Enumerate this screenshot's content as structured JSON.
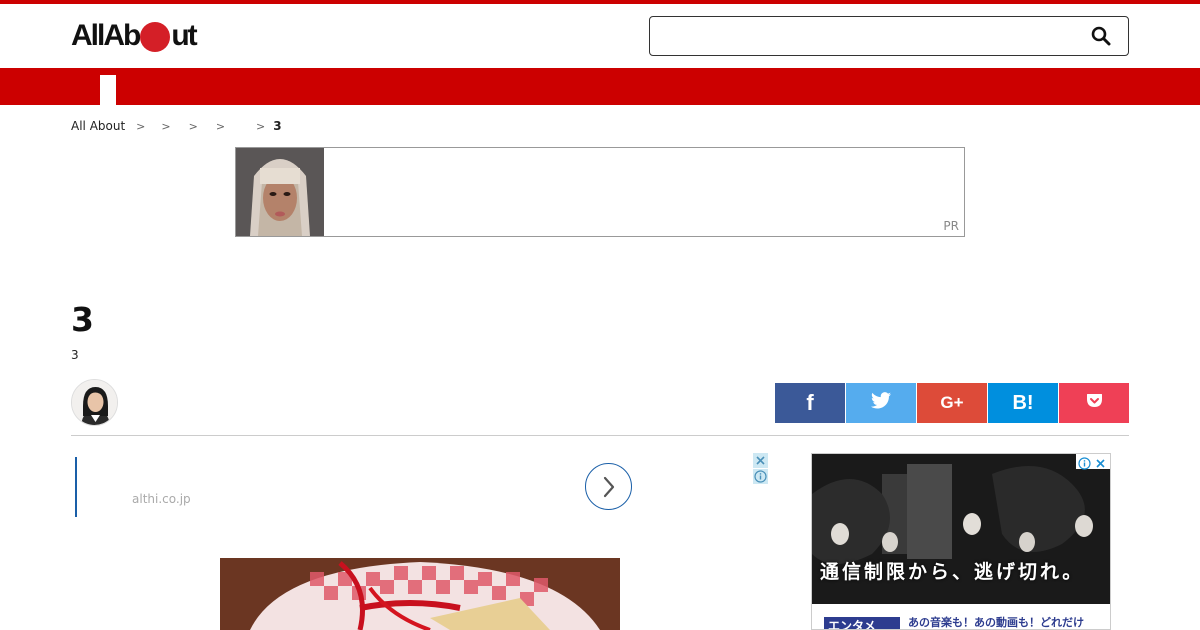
{
  "header": {
    "logo": {
      "part1": "All",
      "part2": "Ab",
      "part3": "ut"
    },
    "search": {
      "value": "",
      "placeholder": ""
    }
  },
  "breadcrumb": {
    "root": "All About",
    "separator": ">",
    "current": "3"
  },
  "pr_banner": {
    "label": "PR"
  },
  "article": {
    "title": "3",
    "subtitle": "3"
  },
  "share": {
    "facebook": "f",
    "gplus": "G+",
    "hatena": "B!"
  },
  "text_ad": {
    "domain": "althi.co.jp"
  },
  "side_ad": {
    "caption": "通信制限から、逃げ切れ。",
    "tag": "エンタメ",
    "line": "あの音楽も！あの動画も！どれだけ"
  },
  "colors": {
    "brand_red": "#cc0000",
    "facebook": "#3b5998",
    "twitter": "#55acee",
    "gplus": "#dd4b39",
    "hatena": "#008fde",
    "pocket": "#ef4056"
  }
}
